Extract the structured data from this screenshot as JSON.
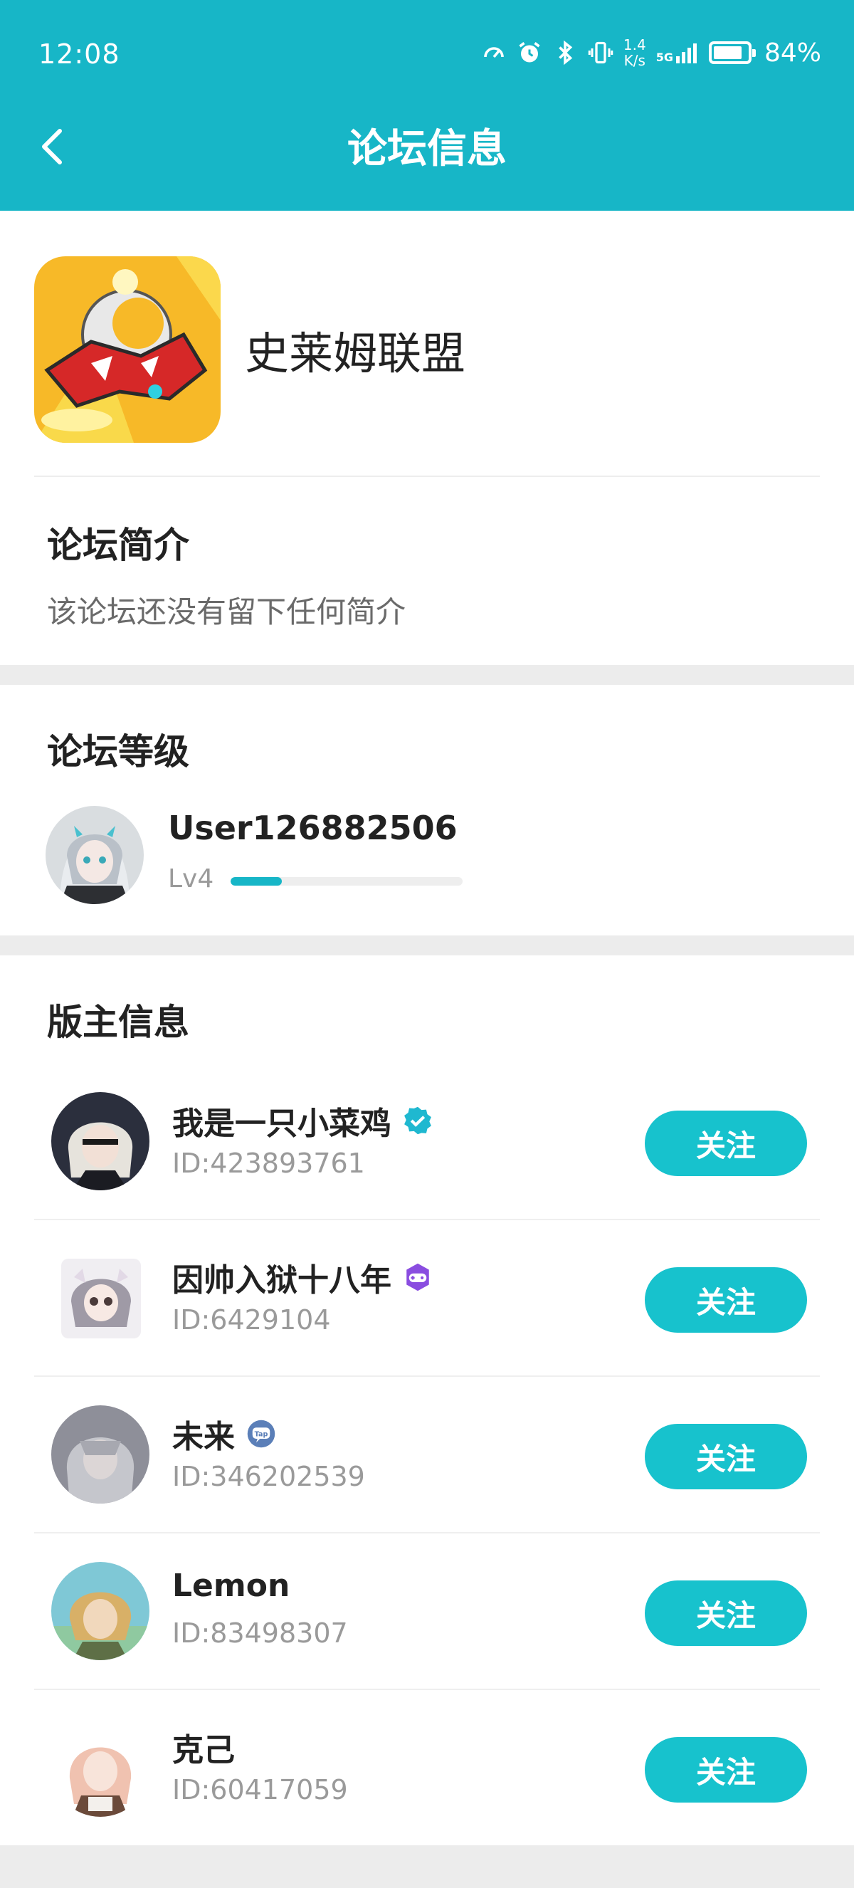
{
  "status_bar": {
    "time": "12:08",
    "net_speed_value": "1.4",
    "net_speed_unit": "K/s",
    "signal": "5G",
    "battery_percent": "84%"
  },
  "header": {
    "title": "论坛信息"
  },
  "forum": {
    "name": "史莱姆联盟",
    "intro_title": "论坛简介",
    "intro_text": "该论坛还没有留下任何简介"
  },
  "level_section": {
    "title": "论坛等级",
    "user_name": "User126882506",
    "level_label": "Lv4",
    "progress_fraction": 0.22
  },
  "moderators": {
    "title": "版主信息",
    "follow_label": "关注",
    "items": [
      {
        "name": "我是一只小菜鸡",
        "id": "ID:423893761",
        "badge": "verified-icon"
      },
      {
        "name": "因帅入狱十八年",
        "id": "ID:6429104",
        "badge": "gamepad-badge-icon"
      },
      {
        "name": "未来",
        "id": "ID:346202539",
        "badge": "tap-badge-icon"
      },
      {
        "name": "Lemon",
        "id": "ID:83498307",
        "badge": ""
      },
      {
        "name": "克己",
        "id": "ID:60417059",
        "badge": ""
      }
    ]
  },
  "colors": {
    "accent": "#17b6c7",
    "follow_button": "#17c2cd",
    "verified": "#1fb8d0",
    "game_badge": "#8a4de0",
    "tap_badge": "#5b7fb8"
  }
}
